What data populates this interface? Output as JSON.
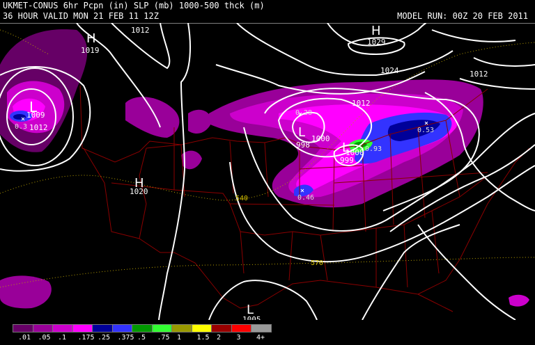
{
  "header": {
    "line1": "UKMET-CONUS 6hr Pcpn (in) SLP (mb) 1000-500 thck (m)",
    "line2": "36 HOUR VALID MON 21 FEB 11 12Z",
    "model_run": "MODEL RUN: 00Z 20 FEB 2011"
  },
  "map": {
    "pressure_centers": [
      {
        "type": "H",
        "value": "1019"
      },
      {
        "type": "H",
        "value": "1029"
      },
      {
        "type": "H",
        "value": "1020"
      },
      {
        "type": "L",
        "value": "1009"
      },
      {
        "type": "L",
        "value": "998"
      },
      {
        "type": "L",
        "value": "999"
      },
      {
        "type": "L",
        "value": "1005"
      }
    ],
    "isobar_labels": [
      "1012",
      "1024",
      "1012",
      "1012",
      "1000",
      "1000",
      "1012"
    ],
    "thickness_labels": [
      "540",
      "570"
    ],
    "precip_max_labels": [
      "0.28",
      "0.46",
      "0.53",
      "0.93",
      "0.3"
    ]
  },
  "legend": {
    "colors": [
      "#660066",
      "#990099",
      "#cc00cc",
      "#ff00ff",
      "#000099",
      "#3333ff",
      "#009900",
      "#33ff33",
      "#999900",
      "#ffff00",
      "#990000",
      "#ff0000",
      "#999999"
    ],
    "labels": [
      ".01",
      ".05",
      ".1",
      ".175",
      ".25",
      ".375",
      ".5",
      ".75",
      "1",
      "1.5",
      "2",
      "3",
      "4+"
    ]
  }
}
